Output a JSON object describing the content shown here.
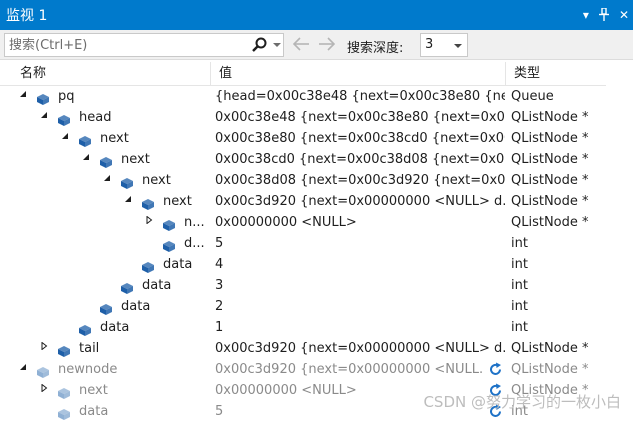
{
  "window": {
    "title": "监视 1",
    "dropdown_glyph": "▾",
    "pin_glyph": "⊕",
    "close_glyph": "✕"
  },
  "toolbar": {
    "search_placeholder": "搜索(Ctrl+E)",
    "back_glyph": "←",
    "forward_glyph": "→",
    "depth_label": "搜索深度:",
    "depth_value": "3"
  },
  "columns": {
    "name": "名称",
    "value": "值",
    "type": "类型"
  },
  "rows": [
    {
      "name": "pq",
      "value": "{head=0x00c38e48 {next=0x00c38e80 {ne...",
      "type": "Queue",
      "level": 0,
      "expander": "expanded",
      "stale": false
    },
    {
      "name": "head",
      "value": "0x00c38e48 {next=0x00c38e80 {next=0x00...",
      "type": "QListNode *",
      "level": 1,
      "expander": "expanded",
      "stale": false
    },
    {
      "name": "next",
      "value": "0x00c38e80 {next=0x00c38cd0 {next=0x00...",
      "type": "QListNode *",
      "level": 2,
      "expander": "expanded",
      "stale": false
    },
    {
      "name": "next",
      "value": "0x00c38cd0 {next=0x00c38d08 {next=0x00...",
      "type": "QListNode *",
      "level": 3,
      "expander": "expanded",
      "stale": false
    },
    {
      "name": "next",
      "value": "0x00c38d08 {next=0x00c3d920 {next=0x0...",
      "type": "QListNode *",
      "level": 4,
      "expander": "expanded",
      "stale": false
    },
    {
      "name": "next",
      "value": "0x00c3d920 {next=0x00000000 <NULL> d...",
      "type": "QListNode *",
      "level": 5,
      "expander": "expanded",
      "stale": false
    },
    {
      "name": "n...",
      "value": "0x00000000 <NULL>",
      "type": "QListNode *",
      "level": 6,
      "expander": "collapsed",
      "stale": false
    },
    {
      "name": "d...",
      "value": "5",
      "type": "int",
      "level": 6,
      "expander": "none",
      "stale": false
    },
    {
      "name": "data",
      "value": "4",
      "type": "int",
      "level": 5,
      "expander": "none",
      "stale": false
    },
    {
      "name": "data",
      "value": "3",
      "type": "int",
      "level": 4,
      "expander": "none",
      "stale": false
    },
    {
      "name": "data",
      "value": "2",
      "type": "int",
      "level": 3,
      "expander": "none",
      "stale": false
    },
    {
      "name": "data",
      "value": "1",
      "type": "int",
      "level": 2,
      "expander": "none",
      "stale": false
    },
    {
      "name": "tail",
      "value": "0x00c3d920 {next=0x00000000 <NULL> d...",
      "type": "QListNode *",
      "level": 1,
      "expander": "collapsed",
      "stale": false
    },
    {
      "name": "newnode",
      "value": "0x00c3d920 {next=0x00000000 <NULL...",
      "type": "QListNode *",
      "level": 0,
      "expander": "expanded",
      "stale": true,
      "refresh": true
    },
    {
      "name": "next",
      "value": "0x00000000 <NULL>",
      "type": "QListNode *",
      "level": 1,
      "expander": "collapsed",
      "stale": true,
      "refresh": true
    },
    {
      "name": "data",
      "value": "5",
      "type": "int",
      "level": 1,
      "expander": "none",
      "stale": true,
      "refresh": true
    }
  ],
  "watermark": "CSDN @努力学习的一枚小白",
  "colors": {
    "accent": "#007acc",
    "cube_active": "#1e5fa8",
    "cube_stale": "#8fb0d4",
    "refresh": "#1e72c7"
  }
}
